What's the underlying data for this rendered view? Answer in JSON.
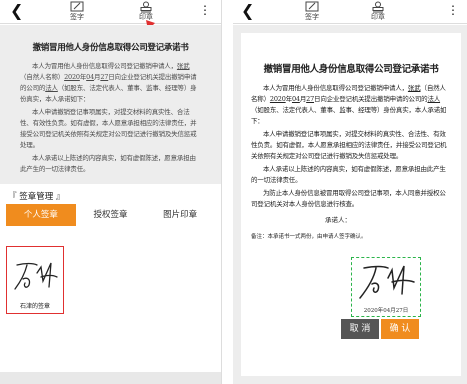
{
  "toolbar": {
    "sign_label": "签字",
    "stamp_label": "印章"
  },
  "document": {
    "title": "撤销冒用他人身份信息取得公司登记承诺书",
    "para1_a": "本人为冒用他人身份信息取得公司登记撤销申请人，",
    "para1_name": "张武",
    "para1_b": "（自然人名称）",
    "para1_year": "2020",
    "para1_c": "年",
    "para1_month": "04",
    "para1_d": "月",
    "para1_day": "27",
    "para1_e": "日向企业登记机关提出撤销申请的公司的",
    "para1_role": "法人",
    "para1_f": "（如股东、法定代表人、董事、监事、经理等）身份真实，本人承诺如下：",
    "para2": "本人申请撤销登记事项属实，对提交材料的真实性、合法性、有效性负责。如有虚假，本人愿意承担相应的法律责任，并接受公司登记机关依照有关规定对公司登记进行撤销及失信惩戒处理。",
    "para3": "本人承诺以上陈述的内容真实，如有虚假陈述，愿意承担由此产生的一切法律责任。",
    "para4": "为防止本人身份信息被冒用取得公司登记事项，本人同意并授权公司登记机关对本人身份信息进行核查。",
    "applicant": "承诺人：",
    "sign_date": "2020年04月27日",
    "footnote": "备注：本承诺书一式两份，由申请人签字确认。"
  },
  "sheet": {
    "title": "『 签章管理 』",
    "tabs": [
      "个人签章",
      "授权签章",
      "图片印章"
    ],
    "signature_caption": "石津的签章"
  },
  "actions": {
    "cancel": "取 消",
    "confirm": "确 认"
  },
  "colors": {
    "accent": "#f08c1e",
    "arrow": "#e03030",
    "stamp_border": "#2bb44a"
  }
}
